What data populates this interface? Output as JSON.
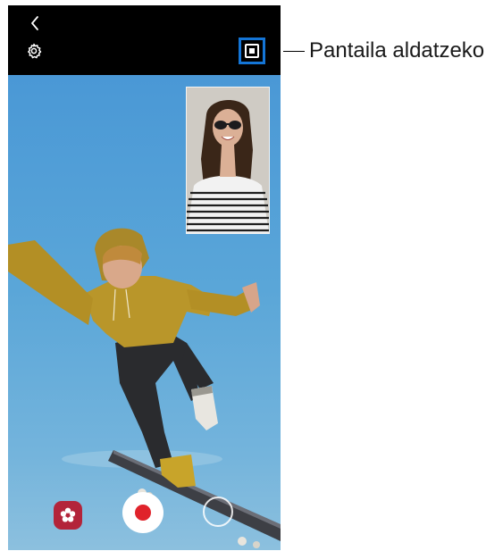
{
  "callout": {
    "label": "Pantaila aldatzeko"
  },
  "toolbar": {
    "back_icon": "chevron-left-icon",
    "settings_icon": "gear-icon",
    "switch_screen_icon": "picture-in-picture-icon"
  },
  "controls": {
    "effects_icon": "flower-effects-icon",
    "record_icon": "record-icon",
    "switch_camera_icon": "switch-camera-icon"
  },
  "colors": {
    "highlight_border": "#1475d6",
    "record_red": "#e0232b",
    "effects_red": "#b3243a",
    "sky_blue": "#5aa6d8"
  }
}
